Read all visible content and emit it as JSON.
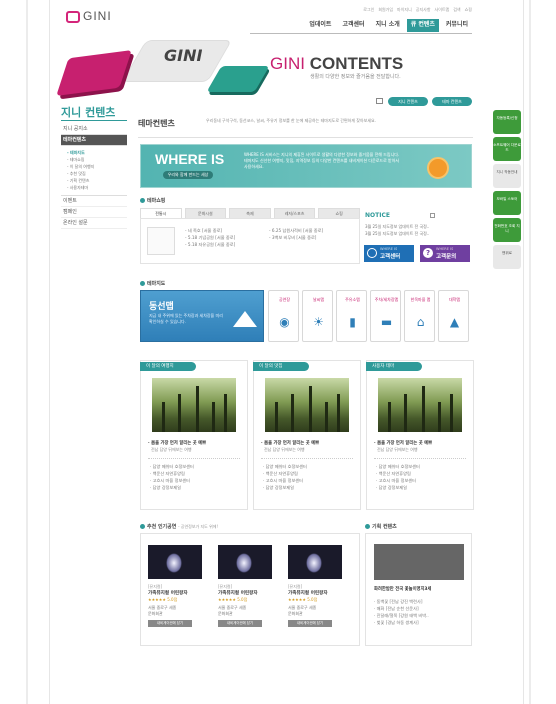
{
  "logo": {
    "text": "GINI"
  },
  "util_nav": [
    "로그인",
    "회원가입",
    "마이지니",
    "공지사항",
    "사이트맵",
    "검색",
    "쇼핑"
  ],
  "main_nav": [
    "업데이트",
    "고객센터",
    "지니 소개",
    "큐 컨텐츠",
    "커뮤니티"
  ],
  "hero": {
    "title_a": "GINI",
    "title_b": "CONTENTS",
    "subtitle": "생활의 다양한 정보와 즐거움을 전달합니다.",
    "graphic_text": "GINI"
  },
  "sidebar": {
    "title": "지니 컨텐츠",
    "menu": [
      "지니 공지소",
      "테마컨텐츠"
    ],
    "sub": [
      "테마지도",
      "테마쇼핑",
      "이 달의 여행지",
      "추천 맛집",
      "기획 컨텐츠",
      "사용자테마"
    ],
    "extra": [
      "이벤트",
      "캠페인",
      "온라인 설문"
    ]
  },
  "top_buttons": [
    "지니 컨텐츠",
    "테마 컨텐츠"
  ],
  "quick_menu": [
    "자동등록/신청",
    "소프트웨어 다운로드",
    "지니 작동안내",
    "모바일 스토어",
    "전화번호 조회 지니",
    "맨위로"
  ],
  "content": {
    "title": "테마컨텐츠",
    "desc": "우리동네 구석구석, 동선코스, 날씨, 주유기 정보를 한 눈에 제공하는 테마지도로 간편하게 찾아보세요."
  },
  "banner": {
    "title": "WHERE IS",
    "button": "우리와 함께 만드는 세상",
    "desc": "WHERE IS 서비스는 지니의 제휴된 사이트로 생활의 다양한 정보와 즐거움을 전해 드립니다. 테마지도 신선한 여행지, 맛집, 지역정보 등의 다양한 컨텐츠를 내비게이션 다운로드로 받아서 사용하세요."
  },
  "theme_shopping": {
    "header": "테마쇼핑",
    "tabs": [
      "전통시",
      "문화시설",
      "축제",
      "레저/스포츠",
      "쇼핑"
    ],
    "col1": [
      "- 네 족호 [서울 중로]",
      "- 5.18 기념공원 [서울 중로]",
      "- 5.18 자유공원 [서울 중로]"
    ],
    "col2": [
      "- 6.25 납원사적비 [서울 중로]",
      "- 3백보 비무비 [서울 중로]"
    ]
  },
  "notice": {
    "label": "NOTICE",
    "items": [
      "3월 25일 지도정보 업데이트 전 국정..",
      "3월 25일 지도정보 업데이트 전 국정.."
    ],
    "btn1_top": "WHERE IS",
    "btn1": "고객센터",
    "btn2_top": "WHERE IS",
    "btn2": "고객문의"
  },
  "theme_map": {
    "header": "테마지도",
    "feature_title": "동선맵",
    "feature_desc": "지금 내 주위에 있는 주차장과 세차장을 미리 확인하실 수 있습니다.",
    "icons": [
      "공연장",
      "날씨맵",
      "주유소맵",
      "주차/세차장맵",
      "한옥마을 맵",
      "대학맵"
    ]
  },
  "cards": [
    {
      "tag": "이 달의 여행지",
      "title": "· 봄을 가장 먼저 알리는 곳 예쁘",
      "sub": "전남 담양 뒤에보는 여행",
      "list": [
        "· 담양 메쉬터 호정보센터",
        "· 백운산 자연휴양림",
        "· 고흐시 마을 정보센터",
        "· 담양 강정보제일"
      ]
    },
    {
      "tag": "이 달의 맛집",
      "title": "· 봄을 가장 먼저 알리는 곳 예쁘",
      "sub": "전남 담양 뒤에보는 여행",
      "list": [
        "· 담양 메쉬터 호정보센터",
        "· 백운산 자연휴양림",
        "· 고흐시 마을 정보센터",
        "· 담양 강정보제일"
      ]
    },
    {
      "tag": "사용자 테마",
      "title": "· 봄을 가장 먼저 알리는 곳 예쁘",
      "sub": "전남 담양 뒤에보는 여행",
      "list": [
        "· 담양 메쉬터 호정보센터",
        "· 백운산 자연휴양림",
        "· 고흐시 마을 정보센터",
        "· 담양 강정보제일"
      ]
    }
  ],
  "performances": {
    "header": "추천 인기공연",
    "subheader": "- 공연정보가 지도 위에!",
    "items": [
      {
        "genre": "[뮤지컬]",
        "title": "가족뮤지컬 어린왕자",
        "rating": "★★★★★ 5.0점",
        "place": "서울 중로구 세종",
        "venue": "문화회관",
        "btn": "내비게이션에 담기"
      },
      {
        "genre": "[뮤지컬]",
        "title": "가족뮤지컬 어린왕자",
        "rating": "★★★★★ 5.0점",
        "place": "서울 중로구 세종",
        "venue": "문화회관",
        "btn": "내비게이션에 담기"
      },
      {
        "genre": "[뮤지컬]",
        "title": "가족뮤지컬 어린왕자",
        "rating": "★★★★★ 5.0점",
        "place": "서울 중로구 세종",
        "venue": "문화회관",
        "btn": "내비게이션에 담기"
      }
    ]
  },
  "special": {
    "header": "기획 컨텐츠",
    "title": "화려한밤만 전국 꽃놀이명지3세",
    "list": [
      "· 동백꽃 [전남 강진 백련사]",
      "· 매화 [전남 순천 선운사]",
      "· 진달래/철쭉 [강원 태백 비박..",
      "· 벚꽃 [경남 하동 쌍계사]"
    ]
  },
  "colors": {
    "teal": "#2f9a99",
    "pink": "#d4257a",
    "green": "#3e9b3a"
  }
}
